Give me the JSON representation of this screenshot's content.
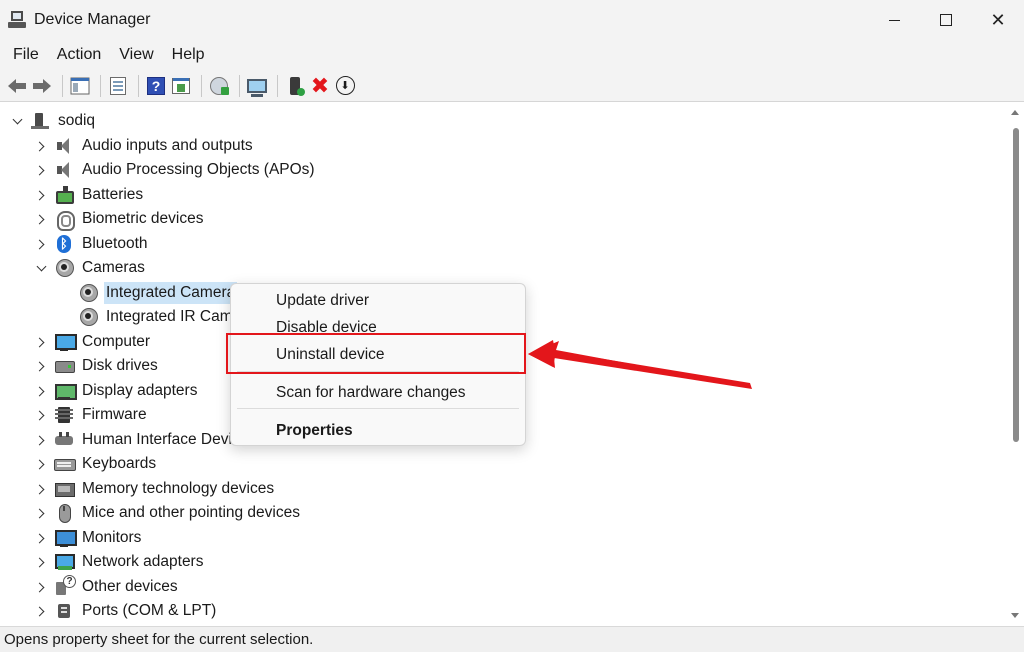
{
  "window": {
    "title": "Device Manager",
    "controls": {
      "minimize": "minimize",
      "maximize": "maximize",
      "close": "✕"
    }
  },
  "menubar": [
    "File",
    "Action",
    "View",
    "Help"
  ],
  "toolbar": {
    "icons": [
      "back-arrow-icon",
      "forward-arrow-icon",
      "show-hide-console-tree-icon",
      "properties-list-icon",
      "help-icon",
      "properties-icon",
      "scan-hardware-icon",
      "monitor-icon",
      "add-driver-icon",
      "uninstall-x-icon",
      "download-driver-icon"
    ],
    "help_glyph": "?",
    "x_glyph": "✖",
    "down_glyph": "⬇"
  },
  "tree": {
    "root": "sodiq",
    "items": [
      {
        "label": "Audio inputs and outputs",
        "icon": "speaker-icon"
      },
      {
        "label": "Audio Processing Objects (APOs)",
        "icon": "speaker-icon"
      },
      {
        "label": "Batteries",
        "icon": "battery-icon"
      },
      {
        "label": "Biometric devices",
        "icon": "fingerprint-icon"
      },
      {
        "label": "Bluetooth",
        "icon": "bluetooth-icon"
      },
      {
        "label": "Cameras",
        "icon": "camera-icon",
        "expanded": true,
        "children": [
          {
            "label": "Integrated Camera",
            "icon": "camera-icon",
            "selected": true
          },
          {
            "label": "Integrated IR Came",
            "icon": "camera-icon"
          }
        ]
      },
      {
        "label": "Computer",
        "icon": "computer-icon"
      },
      {
        "label": "Disk drives",
        "icon": "disk-icon"
      },
      {
        "label": "Display adapters",
        "icon": "display-adapter-icon"
      },
      {
        "label": "Firmware",
        "icon": "firmware-icon"
      },
      {
        "label": "Human Interface Devic",
        "icon": "hid-icon"
      },
      {
        "label": "Keyboards",
        "icon": "keyboard-icon"
      },
      {
        "label": "Memory technology devices",
        "icon": "memory-icon"
      },
      {
        "label": "Mice and other pointing devices",
        "icon": "mouse-icon"
      },
      {
        "label": "Monitors",
        "icon": "monitor-icon"
      },
      {
        "label": "Network adapters",
        "icon": "network-icon"
      },
      {
        "label": "Other devices",
        "icon": "other-device-icon"
      },
      {
        "label": "Ports (COM & LPT)",
        "icon": "ports-icon"
      }
    ]
  },
  "context_menu": {
    "items": [
      "Update driver",
      "Disable device",
      "Uninstall device",
      "Scan for hardware changes",
      "Properties"
    ],
    "highlighted": "Uninstall device",
    "highlight_color": "#e3161b"
  },
  "statusbar": {
    "text": "Opens property sheet for the current selection."
  },
  "colors": {
    "selection": "#cce4f7",
    "annotation": "#e3161b"
  }
}
